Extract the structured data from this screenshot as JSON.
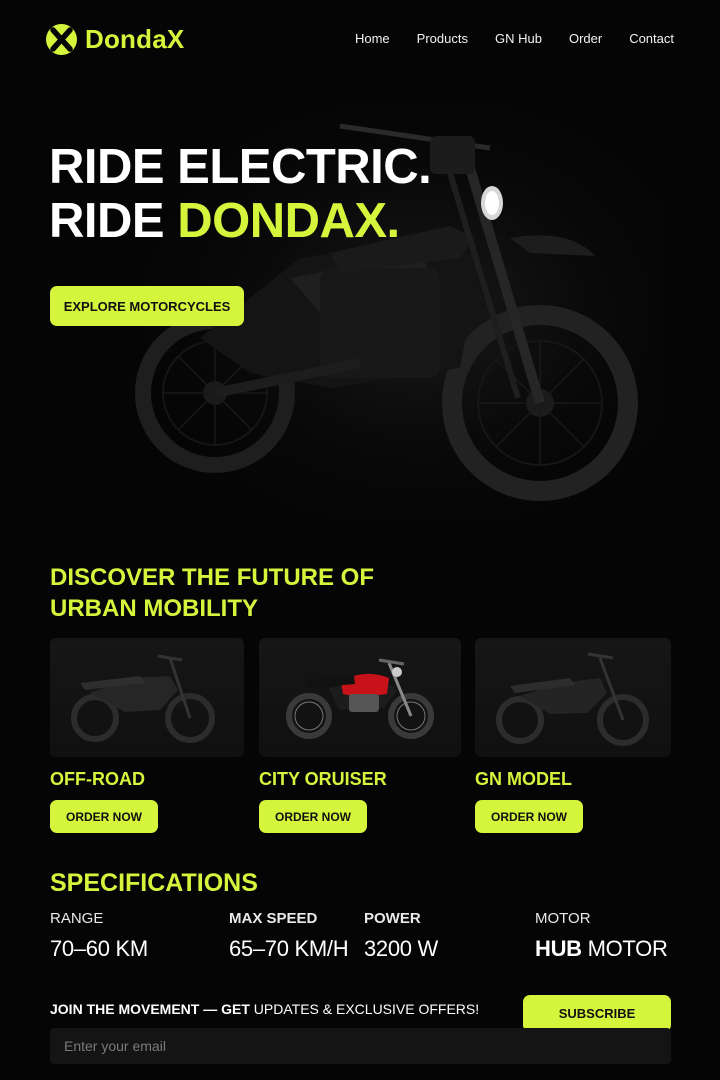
{
  "brand": {
    "name": "DondaX",
    "accent_color": "#d4f53c"
  },
  "nav": {
    "links": [
      "Home",
      "Products",
      "GN Hub",
      "Order",
      "Contact"
    ]
  },
  "hero": {
    "line1": "RIDE ELECTRIC.",
    "line2_prefix": "RIDE ",
    "line2_accent": "DONDAX.",
    "cta": "EXPLORE MOTORCYCLES"
  },
  "discover": {
    "title_line1": "DISCOVER THE FUTURE OF",
    "title_line2": "URBAN MOBILITY",
    "models": [
      {
        "name": "OFF-ROAD",
        "cta": "ORDER NOW",
        "bike_color": "#2a2a2a"
      },
      {
        "name": "CITY ORUISER",
        "cta": "ORDER NOW",
        "bike_color": "#c8121a"
      },
      {
        "name": "GN MODEL",
        "cta": "ORDER NOW",
        "bike_color": "#2a2a2a"
      }
    ]
  },
  "specs": {
    "title": "SPECIFICATIONS",
    "items": [
      {
        "label": "RANGE",
        "value": "70–60 KM"
      },
      {
        "label": "MAX SPEED",
        "value": "65–70 KM/H"
      },
      {
        "label": "POWER",
        "value": "3200 W"
      },
      {
        "label": "MOTOR",
        "value_bold": "HUB",
        "value_rest": " MOTOR"
      }
    ]
  },
  "subscribe": {
    "text_bold": "JOIN THE MOVEMENT — GET",
    "text_rest": " UPDATES & EXCLUSIVE OFFERS!",
    "button": "SUBSCRIBE",
    "placeholder": "Enter your email"
  }
}
